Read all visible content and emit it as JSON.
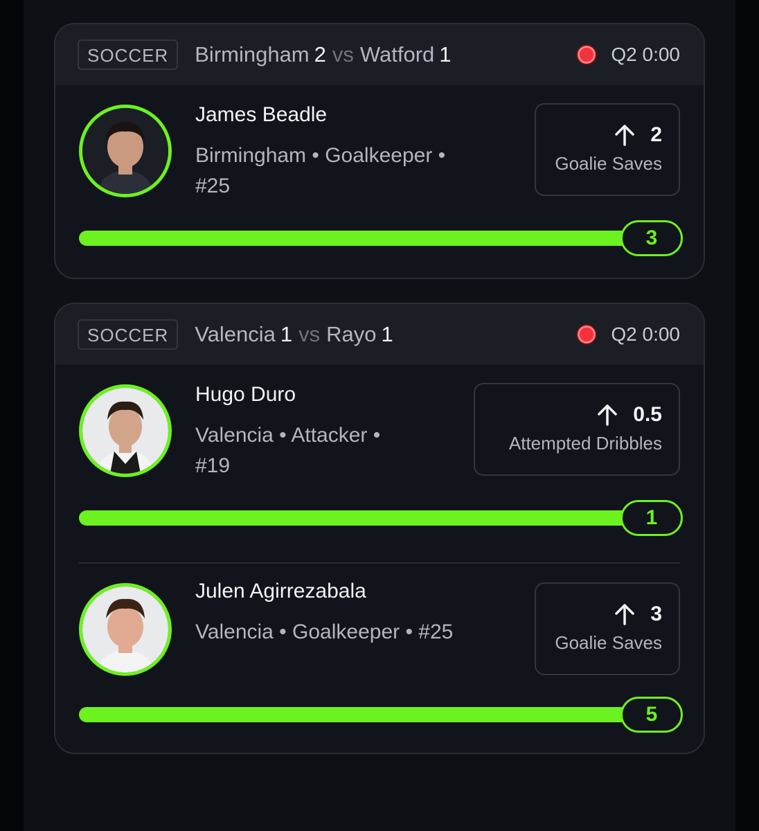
{
  "cards": [
    {
      "sport": "SOCCER",
      "home_team": "Birmingham",
      "home_score": "2",
      "vs": "vs",
      "away_team": "Watford",
      "away_score": "1",
      "game_clock": "Q2 0:00",
      "players": [
        {
          "name": "James Beadle",
          "meta_line1": "Birmingham • Goalkeeper •",
          "meta_line2": "#25",
          "stat_value": "2",
          "stat_label": "Goalie Saves",
          "current": "3",
          "progress_fraction": 1.0
        }
      ]
    },
    {
      "sport": "SOCCER",
      "home_team": "Valencia",
      "home_score": "1",
      "vs": "vs",
      "away_team": "Rayo",
      "away_score": "1",
      "game_clock": "Q2 0:00",
      "players": [
        {
          "name": "Hugo Duro",
          "meta_line1": "Valencia • Attacker •",
          "meta_line2": "#19",
          "stat_value": "0.5",
          "stat_label": "Attempted Dribbles",
          "current": "1",
          "progress_fraction": 1.0
        },
        {
          "name": "Julen Agirrezabala",
          "meta_line1": "Valencia • Goalkeeper • #25",
          "meta_line2": "",
          "stat_value": "3",
          "stat_label": "Goalie Saves",
          "current": "5",
          "progress_fraction": 1.0
        }
      ]
    }
  ],
  "colors": {
    "accent": "#6cf21f",
    "live": "#f2323e"
  },
  "icons": {
    "live": "live-dot-icon",
    "trend": "arrow-up-icon",
    "avatar": "player-avatar-icon"
  }
}
